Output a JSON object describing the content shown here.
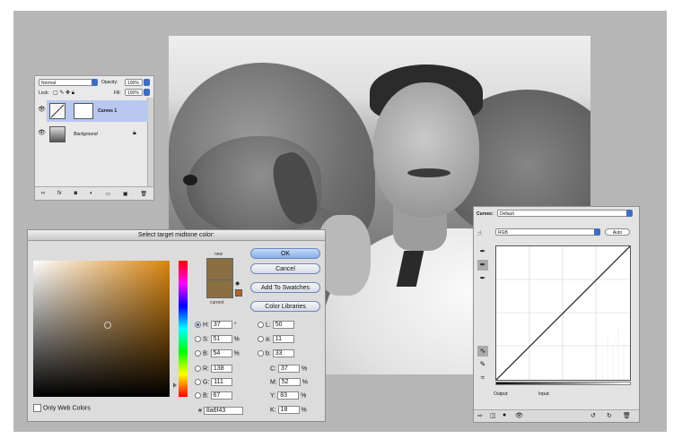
{
  "layers": {
    "blend_mode": "Normal",
    "opacity_label": "Opacity:",
    "opacity_value": "100%",
    "lock_label": "Lock:",
    "fill_label": "Fill:",
    "fill_value": "100%",
    "items": [
      {
        "name": "Curves 1",
        "selected": true
      },
      {
        "name": "Background",
        "selected": false
      }
    ]
  },
  "picker": {
    "title": "Select target midtone color:",
    "new_label": "new",
    "current_label": "current",
    "new_color": "#8a6f43",
    "current_color": "#8a6f43",
    "buttons": {
      "ok": "OK",
      "cancel": "Cancel",
      "add_swatches": "Add To Swatches",
      "color_libraries": "Color Libraries"
    },
    "fields": {
      "H": {
        "label": "H:",
        "value": "37",
        "unit": "°"
      },
      "S": {
        "label": "S:",
        "value": "51",
        "unit": "%"
      },
      "B": {
        "label": "B:",
        "value": "54",
        "unit": "%"
      },
      "R": {
        "label": "R:",
        "value": "138"
      },
      "G": {
        "label": "G:",
        "value": "111"
      },
      "Bl": {
        "label": "B:",
        "value": "67"
      },
      "L": {
        "label": "L:",
        "value": "50"
      },
      "a": {
        "label": "a:",
        "value": "11"
      },
      "b": {
        "label": "b:",
        "value": "33"
      },
      "C": {
        "label": "C:",
        "value": "37",
        "unit": "%"
      },
      "M": {
        "label": "M:",
        "value": "52",
        "unit": "%"
      },
      "Y": {
        "label": "Y:",
        "value": "83",
        "unit": "%"
      },
      "K": {
        "label": "K:",
        "value": "18",
        "unit": "%"
      }
    },
    "hex_label": "#",
    "hex_value": "8a6f43",
    "only_web_colors": "Only Web Colors"
  },
  "curves": {
    "preset_label": "Curves:",
    "preset_value": "Default",
    "channel": "RGB",
    "auto_label": "Auto",
    "output_label": "Output:",
    "input_label": "Input:"
  },
  "colors": {
    "workspace": "#b6b6b6",
    "selection": "#b9c8ef",
    "accent": "#3f6dc0"
  }
}
